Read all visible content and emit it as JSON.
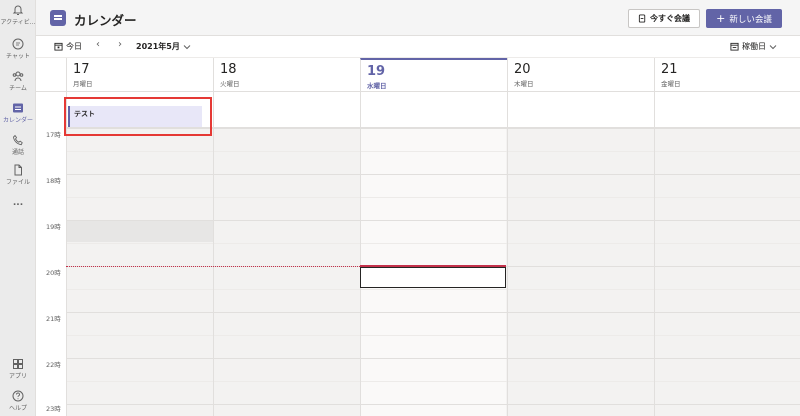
{
  "rail": {
    "items": [
      {
        "label": "アクティビ...",
        "icon": "bell-icon"
      },
      {
        "label": "チャット",
        "icon": "chat-icon"
      },
      {
        "label": "チーム",
        "icon": "teams-icon"
      },
      {
        "label": "カレンダー",
        "icon": "calendar-icon"
      },
      {
        "label": "通話",
        "icon": "phone-icon"
      },
      {
        "label": "ファイル",
        "icon": "file-icon"
      },
      {
        "label": "...",
        "icon": "more-icon"
      },
      {
        "label": "アプリ",
        "icon": "apps-icon"
      },
      {
        "label": "ヘルプ",
        "icon": "help-icon"
      }
    ]
  },
  "header": {
    "title": "カレンダー",
    "meet_now_label": "今すぐ会議",
    "new_meeting_label": "新しい会議"
  },
  "toolbar": {
    "today_label": "今日",
    "month_label": "2021年5月",
    "view_label": "稼働日"
  },
  "days": [
    {
      "num": "17",
      "weekday": "月曜日"
    },
    {
      "num": "18",
      "weekday": "火曜日"
    },
    {
      "num": "19",
      "weekday": "水曜日"
    },
    {
      "num": "20",
      "weekday": "木曜日"
    },
    {
      "num": "21",
      "weekday": "金曜日"
    }
  ],
  "times": [
    "17時",
    "18時",
    "19時",
    "20時",
    "21時",
    "22時",
    "23時"
  ],
  "event": {
    "title": "テスト"
  },
  "colors": {
    "accent": "#6264a7",
    "now_line": "#c4314b",
    "highlight": "#e53935"
  }
}
